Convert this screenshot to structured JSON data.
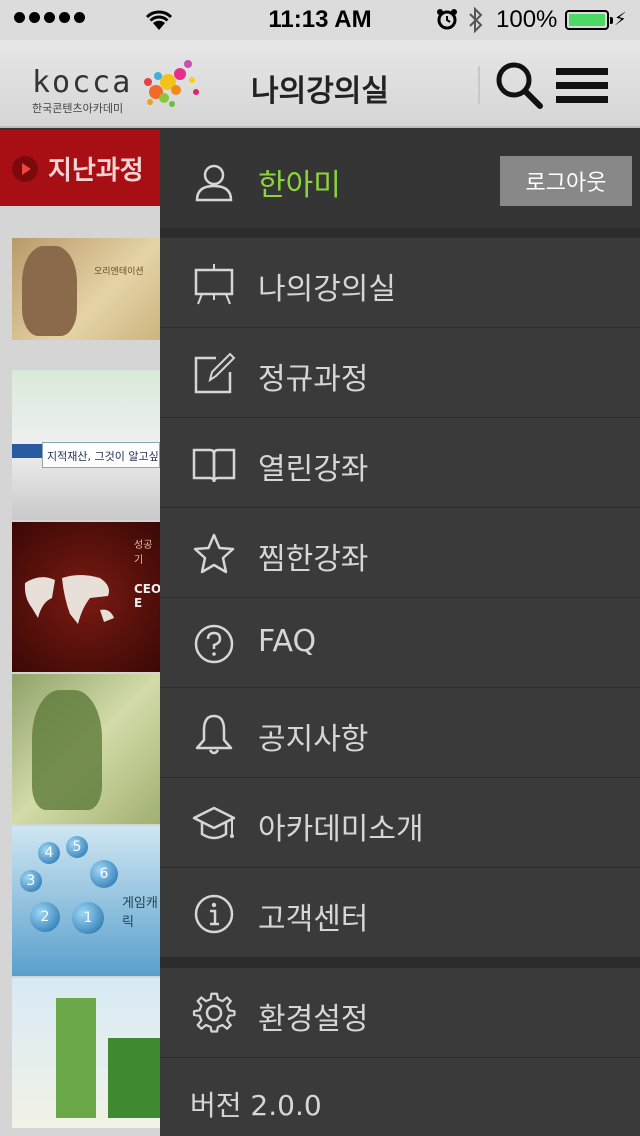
{
  "status_bar": {
    "time": "11:13 AM",
    "battery": "100%",
    "signal_bars": 5,
    "battery_level": 1.0
  },
  "header": {
    "logo_text": "kocca",
    "logo_sub": "한국콘텐츠아카데미",
    "title": "나의강의실",
    "search_icon": "search-icon",
    "menu_icon": "hamburger-icon"
  },
  "left_panel": {
    "tab_label": "지난과정",
    "thumb_text": {
      "t1": "오리엔테이션",
      "t2": "지적재산, 그것이 알고싶",
      "t3_top": "성공기",
      "t3_mid": "CEO E",
      "t5_cap": "게임캐릭"
    }
  },
  "drawer": {
    "user_name": "한아미",
    "logout_label": "로그아웃",
    "menu": [
      {
        "label": "나의강의실",
        "icon": "easel-icon"
      },
      {
        "label": "정규과정",
        "icon": "edit-icon"
      },
      {
        "label": "열린강좌",
        "icon": "book-icon"
      },
      {
        "label": "찜한강좌",
        "icon": "star-icon"
      },
      {
        "label": "FAQ",
        "icon": "question-icon"
      },
      {
        "label": "공지사항",
        "icon": "bell-icon"
      },
      {
        "label": "아카데미소개",
        "icon": "graduation-cap-icon"
      },
      {
        "label": "고객센터",
        "icon": "info-icon"
      }
    ],
    "settings": {
      "label": "환경설정",
      "icon": "gear-icon"
    },
    "version": "버전 2.0.0"
  },
  "colors": {
    "accent_green": "#8bd43a",
    "tab_red": "#a80f14",
    "drawer_bg": "#3a3a3a"
  }
}
